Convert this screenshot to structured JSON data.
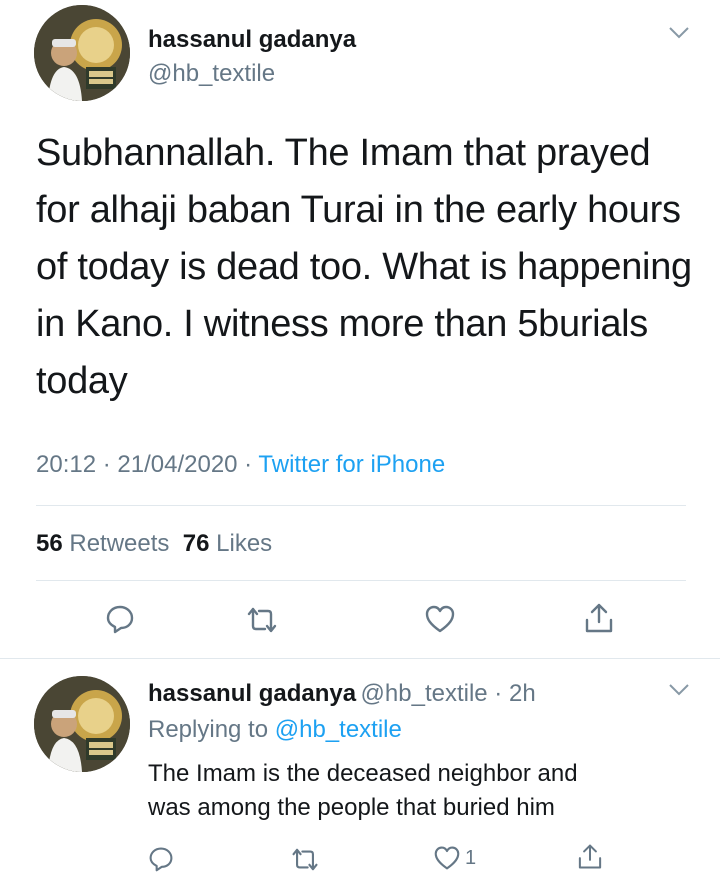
{
  "tweet": {
    "author_name": "hassanul gadanya",
    "author_handle": "@hb_textile",
    "text": "Subhannallah. The Imam that prayed for alhaji baban Turai in the early hours of today is dead too. What is happening in Kano. I witness more than 5burials today",
    "time": "20:12",
    "date": "21/04/2020",
    "source": "Twitter for iPhone",
    "retweets_count": "56",
    "retweets_label": "Retweets",
    "likes_count": "76",
    "likes_label": "Likes"
  },
  "reply": {
    "author_name": "hassanul gadanya",
    "author_handle": "@hb_textile",
    "age": "2h",
    "replying_prefix": "Replying to",
    "replying_to": "@hb_textile",
    "text_line1": "The Imam is the deceased neighbor and",
    "text_line2": "was among the people that buried him",
    "like_count": "1"
  },
  "icons": {
    "reply": "reply-icon",
    "retweet": "retweet-icon",
    "like": "heart-icon",
    "share": "share-icon",
    "more": "chevron-down-icon"
  },
  "colors": {
    "link": "#1da1f2",
    "secondary_text": "#657786",
    "primary_text": "#14171a",
    "divider": "#e1e8ed"
  }
}
